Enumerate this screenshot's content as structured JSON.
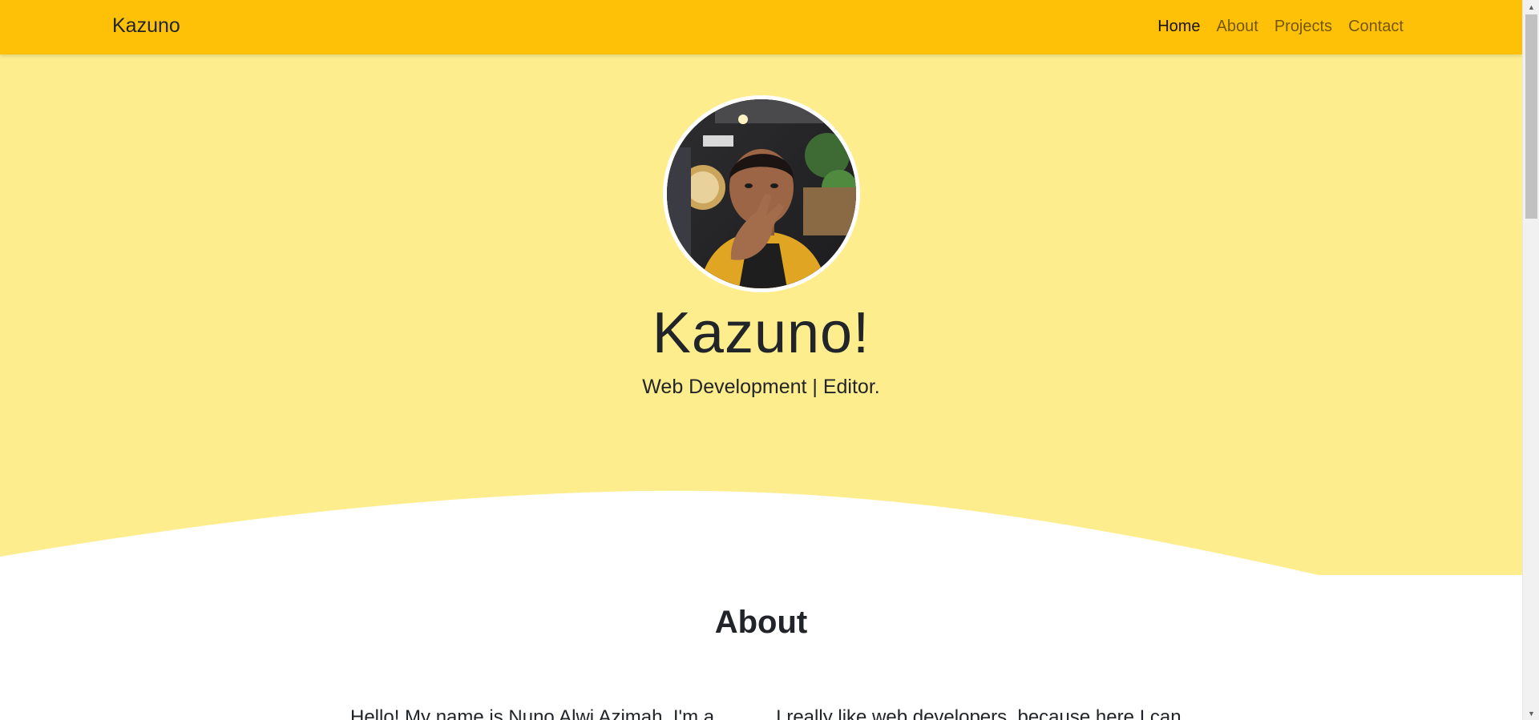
{
  "navbar": {
    "brand": "Kazuno",
    "links": [
      {
        "label": "Home",
        "active": true
      },
      {
        "label": "About",
        "active": false
      },
      {
        "label": "Projects",
        "active": false
      },
      {
        "label": "Contact",
        "active": false
      }
    ]
  },
  "hero": {
    "title": "Kazuno!",
    "subtitle": "Web Development | Editor.",
    "avatar_icon": "profile-photo"
  },
  "about": {
    "title": "About",
    "left_text": "Hello! My name is Nuno Alwi Azimah. I'm a",
    "right_text": "I really like web developers, because here I can"
  },
  "colors": {
    "navbar": "#ffc107",
    "hero_bg": "#feed8c",
    "page_bg": "#ffffff",
    "text": "#212529"
  }
}
